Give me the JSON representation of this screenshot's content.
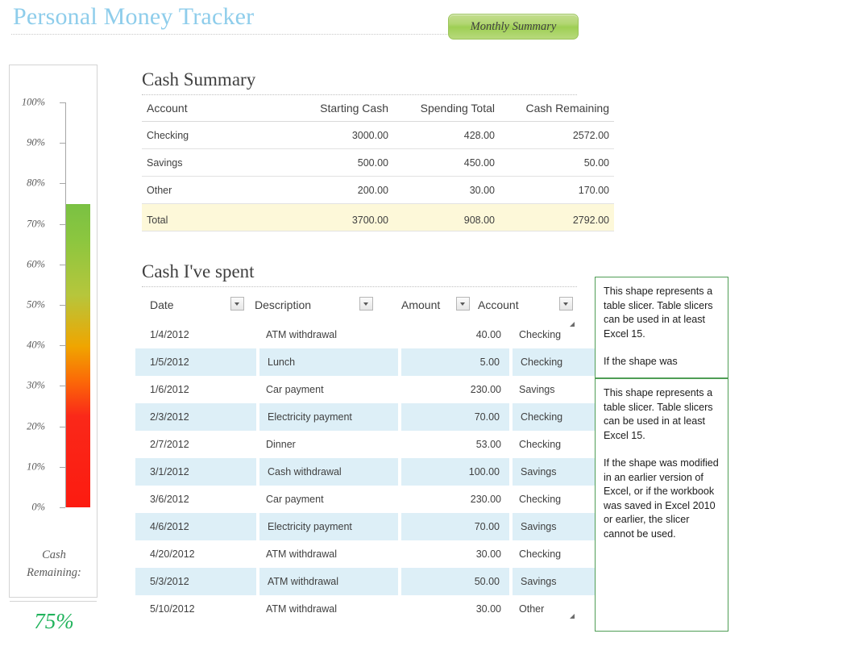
{
  "header": {
    "title": "Personal Money Tracker",
    "summary_button": "Monthly Summary"
  },
  "gauge": {
    "caption_line1": "Cash",
    "caption_line2": "Remaining:",
    "value_label": "75%",
    "value_percent": 75,
    "tick_labels": [
      "100%",
      "90%",
      "80%",
      "70%",
      "60%",
      "50%",
      "40%",
      "30%",
      "20%",
      "10%",
      "0%"
    ],
    "colors": {
      "top": "#7ac143",
      "bottom": "#fc1b10",
      "value_text": "#21b35c"
    }
  },
  "cash_summary": {
    "title": "Cash Summary",
    "columns": [
      "Account",
      "Starting Cash",
      "Spending Total",
      "Cash Remaining"
    ],
    "rows": [
      {
        "account": "Checking",
        "starting": "3000.00",
        "spending": "428.00",
        "remaining": "2572.00"
      },
      {
        "account": "Savings",
        "starting": "500.00",
        "spending": "450.00",
        "remaining": "50.00"
      },
      {
        "account": "Other",
        "starting": "200.00",
        "spending": "30.00",
        "remaining": "170.00"
      }
    ],
    "total": {
      "account": "Total",
      "starting": "3700.00",
      "spending": "908.00",
      "remaining": "2792.00"
    },
    "total_row_color": "#fdf8d9"
  },
  "cash_spent": {
    "title": "Cash I've spent",
    "columns": [
      "Date",
      "Description",
      "Amount",
      "Account"
    ],
    "rows": [
      {
        "date": "1/4/2012",
        "description": "ATM withdrawal",
        "amount": "40.00",
        "account": "Checking"
      },
      {
        "date": "1/5/2012",
        "description": "Lunch",
        "amount": "5.00",
        "account": "Checking"
      },
      {
        "date": "1/6/2012",
        "description": "Car payment",
        "amount": "230.00",
        "account": "Savings"
      },
      {
        "date": "2/3/2012",
        "description": "Electricity payment",
        "amount": "70.00",
        "account": "Checking"
      },
      {
        "date": "2/7/2012",
        "description": "Dinner",
        "amount": "53.00",
        "account": "Checking"
      },
      {
        "date": "3/1/2012",
        "description": "Cash withdrawal",
        "amount": "100.00",
        "account": "Savings"
      },
      {
        "date": "3/6/2012",
        "description": "Car payment",
        "amount": "230.00",
        "account": "Checking"
      },
      {
        "date": "4/6/2012",
        "description": "Electricity payment",
        "amount": "70.00",
        "account": "Savings"
      },
      {
        "date": "4/20/2012",
        "description": "ATM withdrawal",
        "amount": "30.00",
        "account": "Checking"
      },
      {
        "date": "5/3/2012",
        "description": "ATM withdrawal",
        "amount": "50.00",
        "account": "Savings"
      },
      {
        "date": "5/10/2012",
        "description": "ATM withdrawal",
        "amount": "30.00",
        "account": "Other"
      }
    ],
    "band_color": "#ddeff7"
  },
  "slicer_notes": [
    {
      "p1": "This shape represents a table slicer. Table slicers can be used in at least Excel 15.",
      "p2": "If the shape was"
    },
    {
      "p1": "This shape represents a table slicer. Table slicers can be used in at least Excel 15.",
      "p2": "If the shape was modified in an earlier version of Excel, or if the workbook was saved in Excel 2010  or earlier, the slicer cannot be used."
    }
  ]
}
